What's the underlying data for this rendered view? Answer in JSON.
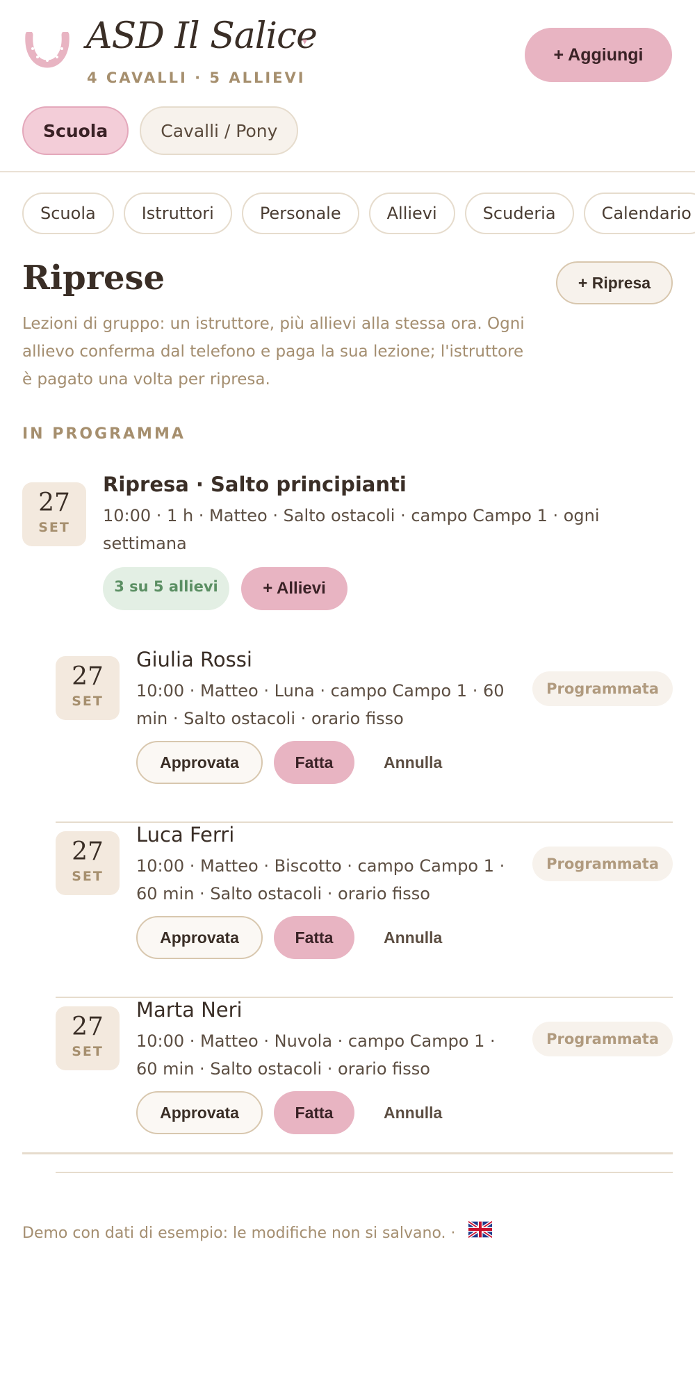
{
  "header": {
    "title": "ASD Il Salice",
    "subtitle": "4 CAVALLI · 5 ALLIEVI",
    "caret": "▾",
    "add_label": "+ Aggiungi",
    "mode_tabs": [
      {
        "label": "Scuola",
        "active": true
      },
      {
        "label": "Cavalli / Pony",
        "active": false
      }
    ]
  },
  "nav": {
    "items": [
      "Scuola",
      "Istruttori",
      "Personale",
      "Allievi",
      "Scuderia",
      "Calendario"
    ]
  },
  "page": {
    "title": "Riprese",
    "add_label": "+ Ripresa",
    "description": "Lezioni di gruppo: un istruttore, più allievi alla stessa ora. Ogni allievo conferma dal telefono e paga la sua lezione; l'istruttore è pagato una volta per ripresa.",
    "section_label": "IN PROGRAMMA"
  },
  "group": {
    "day": "27",
    "month": "SET",
    "title": "Ripresa · Salto principianti",
    "meta": "10:00 · 1 h · Matteo · Salto ostacoli · campo Campo 1 · ogni settimana",
    "count_label": "3 su 5 allievi",
    "add_students_label": "+ Allievi"
  },
  "students": [
    {
      "day": "27",
      "month": "SET",
      "name": "Giulia Rossi",
      "meta": "10:00 · Matteo · Luna · campo Campo 1 · 60 min · Salto ostacoli · orario fisso",
      "status": "Programmata",
      "approve_label": "Approvata",
      "done_label": "Fatta",
      "cancel_label": "Annulla"
    },
    {
      "day": "27",
      "month": "SET",
      "name": "Luca Ferri",
      "meta": "10:00 · Matteo · Biscotto · campo Campo 1 · 60 min · Salto ostacoli · orario fisso",
      "status": "Programmata",
      "approve_label": "Approvata",
      "done_label": "Fatta",
      "cancel_label": "Annulla"
    },
    {
      "day": "27",
      "month": "SET",
      "name": "Marta Neri",
      "meta": "10:00 · Matteo · Nuvola · campo Campo 1 · 60 min · Salto ostacoli · orario fisso",
      "status": "Programmata",
      "approve_label": "Approvata",
      "done_label": "Fatta",
      "cancel_label": "Annulla"
    }
  ],
  "footer": {
    "text": "Demo con dati di esempio: le modifiche non si salvano. ·",
    "language_icon": "uk-flag-icon"
  },
  "colors": {
    "accent_pink": "#e8b4c2",
    "tile_beige": "#f3e9de",
    "muted_gold": "#a68f6e",
    "success_green": "#5b8f63"
  }
}
